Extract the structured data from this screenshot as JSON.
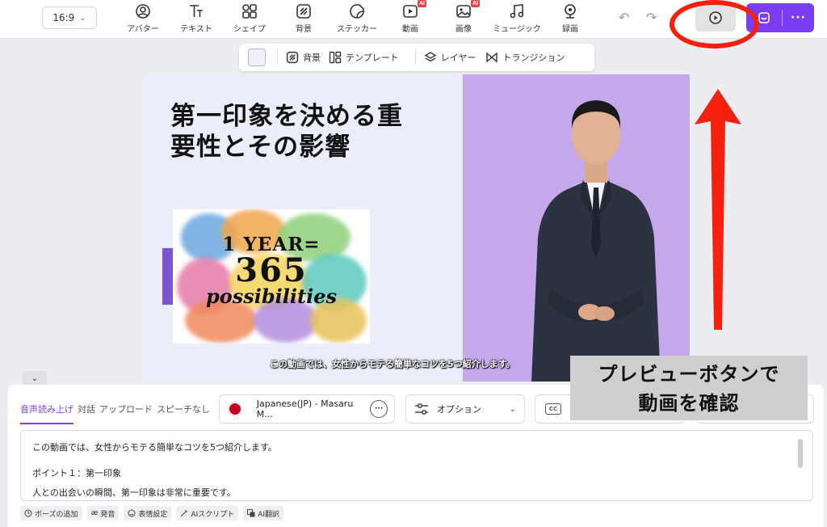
{
  "toolbar": {
    "aspect_ratio": "16:9",
    "tools": [
      {
        "label": "アバター",
        "icon": "avatar-icon"
      },
      {
        "label": "テキスト",
        "icon": "text-icon"
      },
      {
        "label": "シェイプ",
        "icon": "shape-icon"
      },
      {
        "label": "背景",
        "icon": "background-icon"
      },
      {
        "label": "ステッカー",
        "icon": "sticker-icon"
      },
      {
        "label": "動画",
        "icon": "video-icon",
        "badge": "AI"
      },
      {
        "label": "画像",
        "icon": "image-icon",
        "badge": "AI"
      },
      {
        "label": "ミュージック",
        "icon": "music-icon"
      },
      {
        "label": "録画",
        "icon": "record-icon"
      }
    ],
    "more_label": "···"
  },
  "subbar": {
    "background_label": "背景",
    "template_label": "テンプレート",
    "layer_label": "レイヤー",
    "transition_label": "トランジション"
  },
  "slide": {
    "title_line1": "第一印象を決める重",
    "title_line2": "要性とその影響",
    "image_line1": "1 YEAR=",
    "image_line2": "365",
    "image_line3": "possibilities",
    "subtitle": "この動画では、女性からモテる簡単なコツを5つ紹介します。"
  },
  "panel": {
    "tabs": [
      "音声読み上げ",
      "対話",
      "アップロード",
      "スピーチなし"
    ],
    "voice": "Japanese(JP) - Masaru M...",
    "options_label": "オプション",
    "subtitle_label_partial": "字",
    "script_lines": [
      "この動画では、女性からモテる簡単なコツを5つ紹介します。",
      "",
      "ポイント１：第一印象",
      "人との出会いの瞬間、第一印象は非常に重要です。"
    ],
    "chips": [
      {
        "label": "ポーズの追加",
        "icon": "clock-icon"
      },
      {
        "label": "発音",
        "icon": "pronunciation-icon"
      },
      {
        "label": "表情設定",
        "icon": "smile-icon"
      },
      {
        "label": "AIスクリプト",
        "icon": "magic-wand-icon"
      },
      {
        "label": "AI翻訳",
        "icon": "translate-icon"
      }
    ]
  },
  "annotation": {
    "callout_line1": "プレビューボタンで",
    "callout_line2": "動画を確認",
    "color": "#f5200d"
  },
  "colors": {
    "accent": "#7b3df1",
    "canvas_left": "#ecedfb",
    "canvas_right": "#c5a8ee",
    "accent_bar": "#7a55d4"
  }
}
